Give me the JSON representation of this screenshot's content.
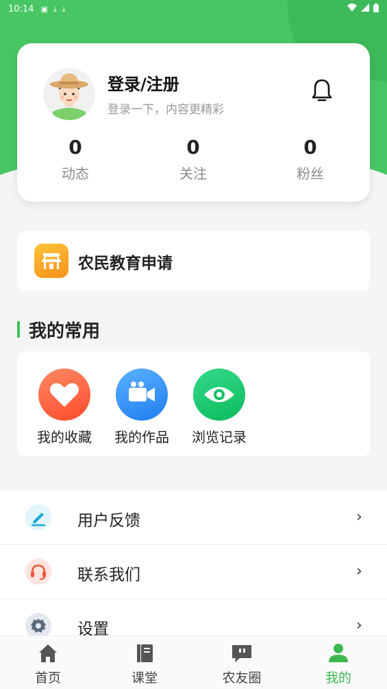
{
  "status_bar": {
    "time": "10:14",
    "left_icons": [
      "app-icon",
      "download-icon",
      "download-icon"
    ],
    "right_icons": [
      "wifi-icon",
      "signal-icon",
      "battery-icon"
    ]
  },
  "profile": {
    "title": "登录/注册",
    "subtitle": "登录一下，内容更精彩",
    "stats": [
      {
        "value": "0",
        "label": "动态"
      },
      {
        "value": "0",
        "label": "关注"
      },
      {
        "value": "0",
        "label": "粉丝"
      }
    ]
  },
  "education": {
    "label": "农民教育申请"
  },
  "common": {
    "title": "我的常用",
    "items": [
      {
        "label": "我的收藏",
        "icon": "heart-icon"
      },
      {
        "label": "我的作品",
        "icon": "video-camera-icon"
      },
      {
        "label": "浏览记录",
        "icon": "eye-icon"
      }
    ]
  },
  "menu": [
    {
      "label": "用户反馈",
      "icon": "edit-icon",
      "chevron": "›"
    },
    {
      "label": "联系我们",
      "icon": "headset-icon",
      "chevron": "›"
    },
    {
      "label": "设置",
      "icon": "gear-icon",
      "chevron": "›"
    }
  ],
  "nav": [
    {
      "label": "首页",
      "icon": "home-icon",
      "active": false
    },
    {
      "label": "课堂",
      "icon": "book-icon",
      "active": false
    },
    {
      "label": "农友圈",
      "icon": "chat-quote-icon",
      "active": false
    },
    {
      "label": "我的",
      "icon": "user-icon",
      "active": true
    }
  ],
  "colors": {
    "brand_green": "#3cc35a",
    "active_nav": "#3cb84e",
    "edu_orange": "#f7921b",
    "heart_red": "#ff5a3c",
    "video_blue": "#2f8cf5",
    "eye_green": "#14c46a"
  }
}
